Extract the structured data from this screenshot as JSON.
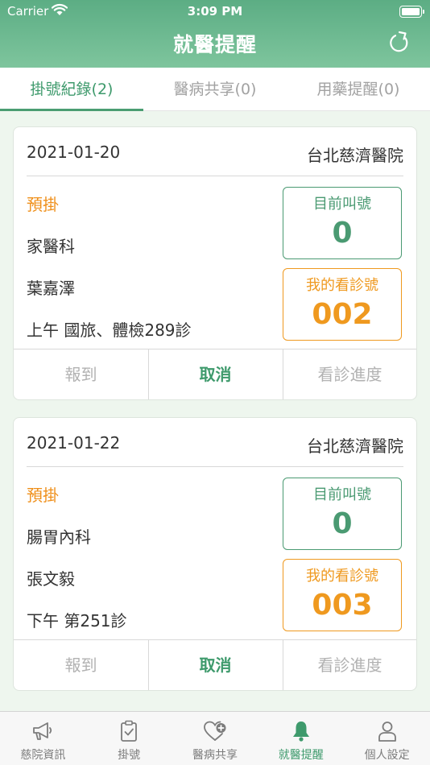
{
  "status_bar": {
    "carrier": "Carrier",
    "time": "3:09 PM"
  },
  "header": {
    "title": "就醫提醒",
    "refresh_icon": "refresh-icon"
  },
  "tabs": [
    {
      "label": "掛號紀錄(2)",
      "active": true
    },
    {
      "label": "醫病共享(0)",
      "active": false
    },
    {
      "label": "用藥提醒(0)",
      "active": false
    }
  ],
  "colors": {
    "accent": "#4a9d72",
    "warning": "#ef991f"
  },
  "cards": [
    {
      "date": "2021-01-20",
      "hospital": "台北慈濟醫院",
      "status": "預掛",
      "department": "家醫科",
      "doctor": "葉嘉澤",
      "session": "上午 國旅、體檢289診",
      "current_label": "目前叫號",
      "current_value": "0",
      "my_label": "我的看診號",
      "my_value": "002",
      "actions": {
        "checkin": "報到",
        "cancel": "取消",
        "progress": "看診進度"
      }
    },
    {
      "date": "2021-01-22",
      "hospital": "台北慈濟醫院",
      "status": "預掛",
      "department": "腸胃內科",
      "doctor": "張文毅",
      "session": "下午 第251診",
      "current_label": "目前叫號",
      "current_value": "0",
      "my_label": "我的看診號",
      "my_value": "003",
      "actions": {
        "checkin": "報到",
        "cancel": "取消",
        "progress": "看診進度"
      }
    }
  ],
  "tabbar": [
    {
      "label": "慈院資訊",
      "icon": "megaphone-icon"
    },
    {
      "label": "掛號",
      "icon": "clipboard-check-icon"
    },
    {
      "label": "醫病共享",
      "icon": "heart-plus-icon"
    },
    {
      "label": "就醫提醒",
      "icon": "bell-icon",
      "active": true
    },
    {
      "label": "個人設定",
      "icon": "person-icon"
    }
  ]
}
